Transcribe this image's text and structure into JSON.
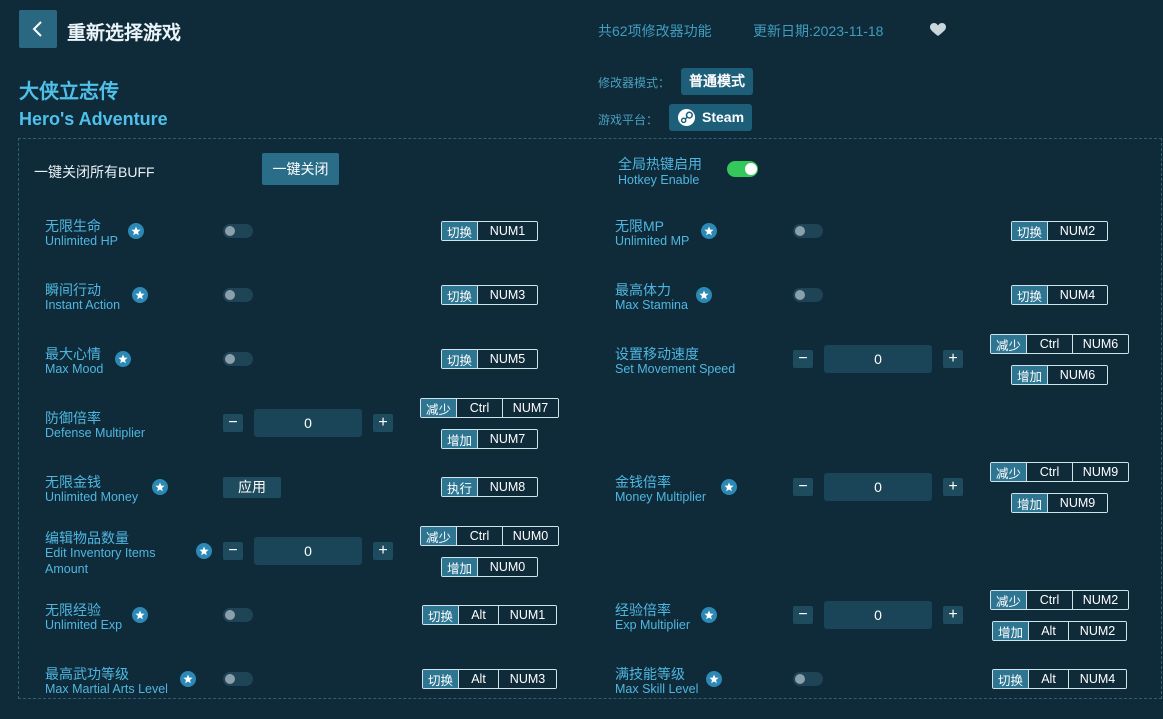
{
  "header": {
    "title": "重新选择游戏",
    "feature_count": "共62项修改器功能",
    "update_date": "更新日期:2023-11-18"
  },
  "game": {
    "name_cn": "大侠立志传",
    "name_en": "Hero's Adventure",
    "mode_label": "修改器模式：",
    "mode_value": "普通模式",
    "platform_label": "游戏平台：",
    "platform_value": "Steam"
  },
  "global": {
    "close_all_label": "一键关闭所有BUFF",
    "close_all_button": "一键关闭",
    "hotkey_cn": "全局热键启用",
    "hotkey_en": "Hotkey Enable",
    "hotkey_enabled": true
  },
  "hk": {
    "toggle": "切换",
    "dec": "减少",
    "inc": "增加",
    "exec": "执行",
    "apply": "应用",
    "ctrl": "Ctrl",
    "alt": "Alt",
    "num0": "NUM0",
    "num1": "NUM1",
    "num2": "NUM2",
    "num3": "NUM3",
    "num4": "NUM4",
    "num5": "NUM5",
    "num6": "NUM6",
    "num7": "NUM7",
    "num8": "NUM8",
    "num9": "NUM9"
  },
  "cheats": {
    "hp": {
      "cn": "无限生命",
      "en": "Unlimited HP",
      "enabled": false
    },
    "mp": {
      "cn": "无限MP",
      "en": "Unlimited MP",
      "enabled": false
    },
    "action": {
      "cn": "瞬间行动",
      "en": "Instant Action",
      "enabled": false
    },
    "stamina": {
      "cn": "最高体力",
      "en": "Max Stamina",
      "enabled": false
    },
    "mood": {
      "cn": "最大心情",
      "en": "Max Mood",
      "enabled": false
    },
    "speed": {
      "cn": "设置移动速度",
      "en": "Set Movement Speed",
      "value": "0"
    },
    "defense": {
      "cn": "防御倍率",
      "en": "Defense Multiplier",
      "value": "0"
    },
    "money": {
      "cn": "无限金钱",
      "en": "Unlimited Money"
    },
    "money_mult": {
      "cn": "金钱倍率",
      "en": "Money Multiplier",
      "value": "0"
    },
    "inventory": {
      "cn": "编辑物品数量",
      "en1": "Edit Inventory Items",
      "en2": "Amount",
      "value": "0"
    },
    "exp": {
      "cn": "无限经验",
      "en": "Unlimited Exp",
      "enabled": false
    },
    "exp_mult": {
      "cn": "经验倍率",
      "en": "Exp Multiplier",
      "value": "0"
    },
    "martial": {
      "cn": "最高武功等级",
      "en": "Max Martial Arts Level",
      "enabled": false
    },
    "skill": {
      "cn": "满技能等级",
      "en": "Max Skill Level",
      "enabled": false
    }
  }
}
